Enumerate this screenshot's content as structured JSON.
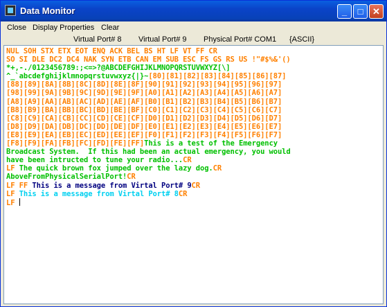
{
  "window": {
    "title": "Data Monitor",
    "buttons": {
      "minimize": "_",
      "maximize": "□",
      "close": "✕"
    }
  },
  "menu": {
    "close": "Close",
    "display_properties": "Display Properties",
    "clear": "Clear"
  },
  "status": {
    "virtual_port_8": "Virtual Port# 8",
    "virtual_port_9": "Virtual Port# 9",
    "physical_port": "Physical Port# COM1",
    "mode": "{ASCII}"
  },
  "colors": {
    "orange": "#ff8000",
    "green": "#00c000",
    "navy": "#000080",
    "cyan": "#00d0f0"
  },
  "lines": [
    [
      {
        "t": "NUL SOH STX ETX EOT ENQ ACK BEL BS HT LF VT FF CR",
        "c": "o"
      }
    ],
    [
      {
        "t": "SO SI DLE DC2 DC4 NAK SYN ETB CAN EM SUB ESC FS GS RS US !\"#$%&'()",
        "c": "o"
      }
    ],
    [
      {
        "t": "*+,-./0123456789:;<=>?@ABCDEFGHIJKLMNOPQRSTUVWXYZ[\\]",
        "c": "g"
      }
    ],
    [
      {
        "t": "^_`abcdefghijklmnopqrstuvwxyz{|}~",
        "c": "g"
      },
      {
        "t": "[80][81][82][83][84][85][86][87]",
        "c": "o"
      }
    ],
    [
      {
        "t": "[88][89][8A][8B][8C][8D][8E][8F][90][91][92][93][94][95][96][97]",
        "c": "o"
      }
    ],
    [
      {
        "t": "[98][99][9A][9B][9C][9D][9E][9F][A0][A1][A2][A3][A4][A5][A6][A7]",
        "c": "o"
      }
    ],
    [
      {
        "t": "[A8][A9][AA][AB][AC][AD][AE][AF][B0][B1][B2][B3][B4][B5][B6][B7]",
        "c": "o"
      }
    ],
    [
      {
        "t": "[B8][B9][BA][BB][BC][BD][BE][BF][C0][C1][C2][C3][C4][C5][C6][C7]",
        "c": "o"
      }
    ],
    [
      {
        "t": "[C8][C9][CA][CB][CC][CD][CE][CF][D0][D1][D2][D3][D4][D5][D6][D7]",
        "c": "o"
      }
    ],
    [
      {
        "t": "[D8][D9][DA][DB][DC][DD][DE][DF][E0][E1][E2][E3][E4][E5][E6][E7]",
        "c": "o"
      }
    ],
    [
      {
        "t": "[E8][E9][EA][EB][EC][ED][EE][EF][F0][F1][F2][F3][F4][F5][F6][F7]",
        "c": "o"
      }
    ],
    [
      {
        "t": "[F8][F9][FA][FB][FC][FD][FE][FF]",
        "c": "o"
      },
      {
        "t": "This is a test of the Emergency",
        "c": "g"
      }
    ],
    [
      {
        "t": "Broadcast System.  If this had been an actual emergency, you would",
        "c": "g"
      }
    ],
    [
      {
        "t": "have been intructed to tune your radio...",
        "c": "g"
      },
      {
        "t": "CR",
        "c": "o"
      }
    ],
    [
      {
        "t": "LF ",
        "c": "o"
      },
      {
        "t": "The quick brown fox jumped over the lazy dog.",
        "c": "g"
      },
      {
        "t": "CR",
        "c": "o"
      }
    ],
    [
      {
        "t": "AboveFromPhysicalSerialPort!",
        "c": "g"
      },
      {
        "t": "CR",
        "c": "o"
      }
    ],
    [
      {
        "t": "LF FF ",
        "c": "o"
      },
      {
        "t": "This is a message from Virtal Port# 9",
        "c": "n"
      },
      {
        "t": "CR",
        "c": "o"
      }
    ],
    [
      {
        "t": "LF ",
        "c": "o"
      },
      {
        "t": "This is a message from Virtal Port# 8",
        "c": "c"
      },
      {
        "t": "CR",
        "c": "o"
      }
    ],
    [
      {
        "t": "LF ",
        "c": "o"
      }
    ]
  ]
}
